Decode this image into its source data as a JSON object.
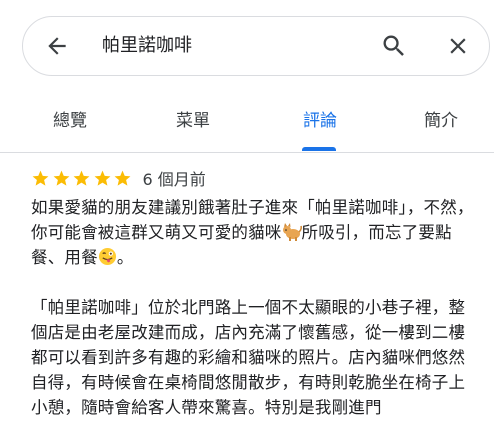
{
  "search": {
    "query": "帕里諾咖啡"
  },
  "tabs": [
    {
      "label": "總覽",
      "active": false
    },
    {
      "label": "菜單",
      "active": false
    },
    {
      "label": "評論",
      "active": true
    },
    {
      "label": "簡介",
      "active": false
    }
  ],
  "review": {
    "stars": 5,
    "date": "6 個月前",
    "para1_a": "如果愛貓的朋友建議別餓著肚子進來「帕里諾咖啡」，不然，你可能會被這群又萌又可愛的貓咪",
    "para1_b": "所吸引，而忘了要點餐、用餐",
    "para1_c": "。",
    "para2": "「帕里諾咖啡」位於北門路上一個不太顯眼的小巷子裡，整個店是由老屋改建而成，店內充滿了懷舊感，從一樓到二樓都可以看到許多有趣的彩繪和貓咪的照片。店內貓咪們悠然自得，有時候會在桌椅間悠閒散步，有時則乾脆坐在椅子上小憩，隨時會給客人帶來驚喜。特別是我剛進門"
  },
  "colors": {
    "accent": "#1a73e8",
    "star": "#fbbc04",
    "text": "#202124"
  },
  "icons": [
    "arrow-back-icon",
    "search-icon",
    "close-icon",
    "star-icon",
    "cat-emoji-icon",
    "face-tongue-emoji-icon"
  ]
}
